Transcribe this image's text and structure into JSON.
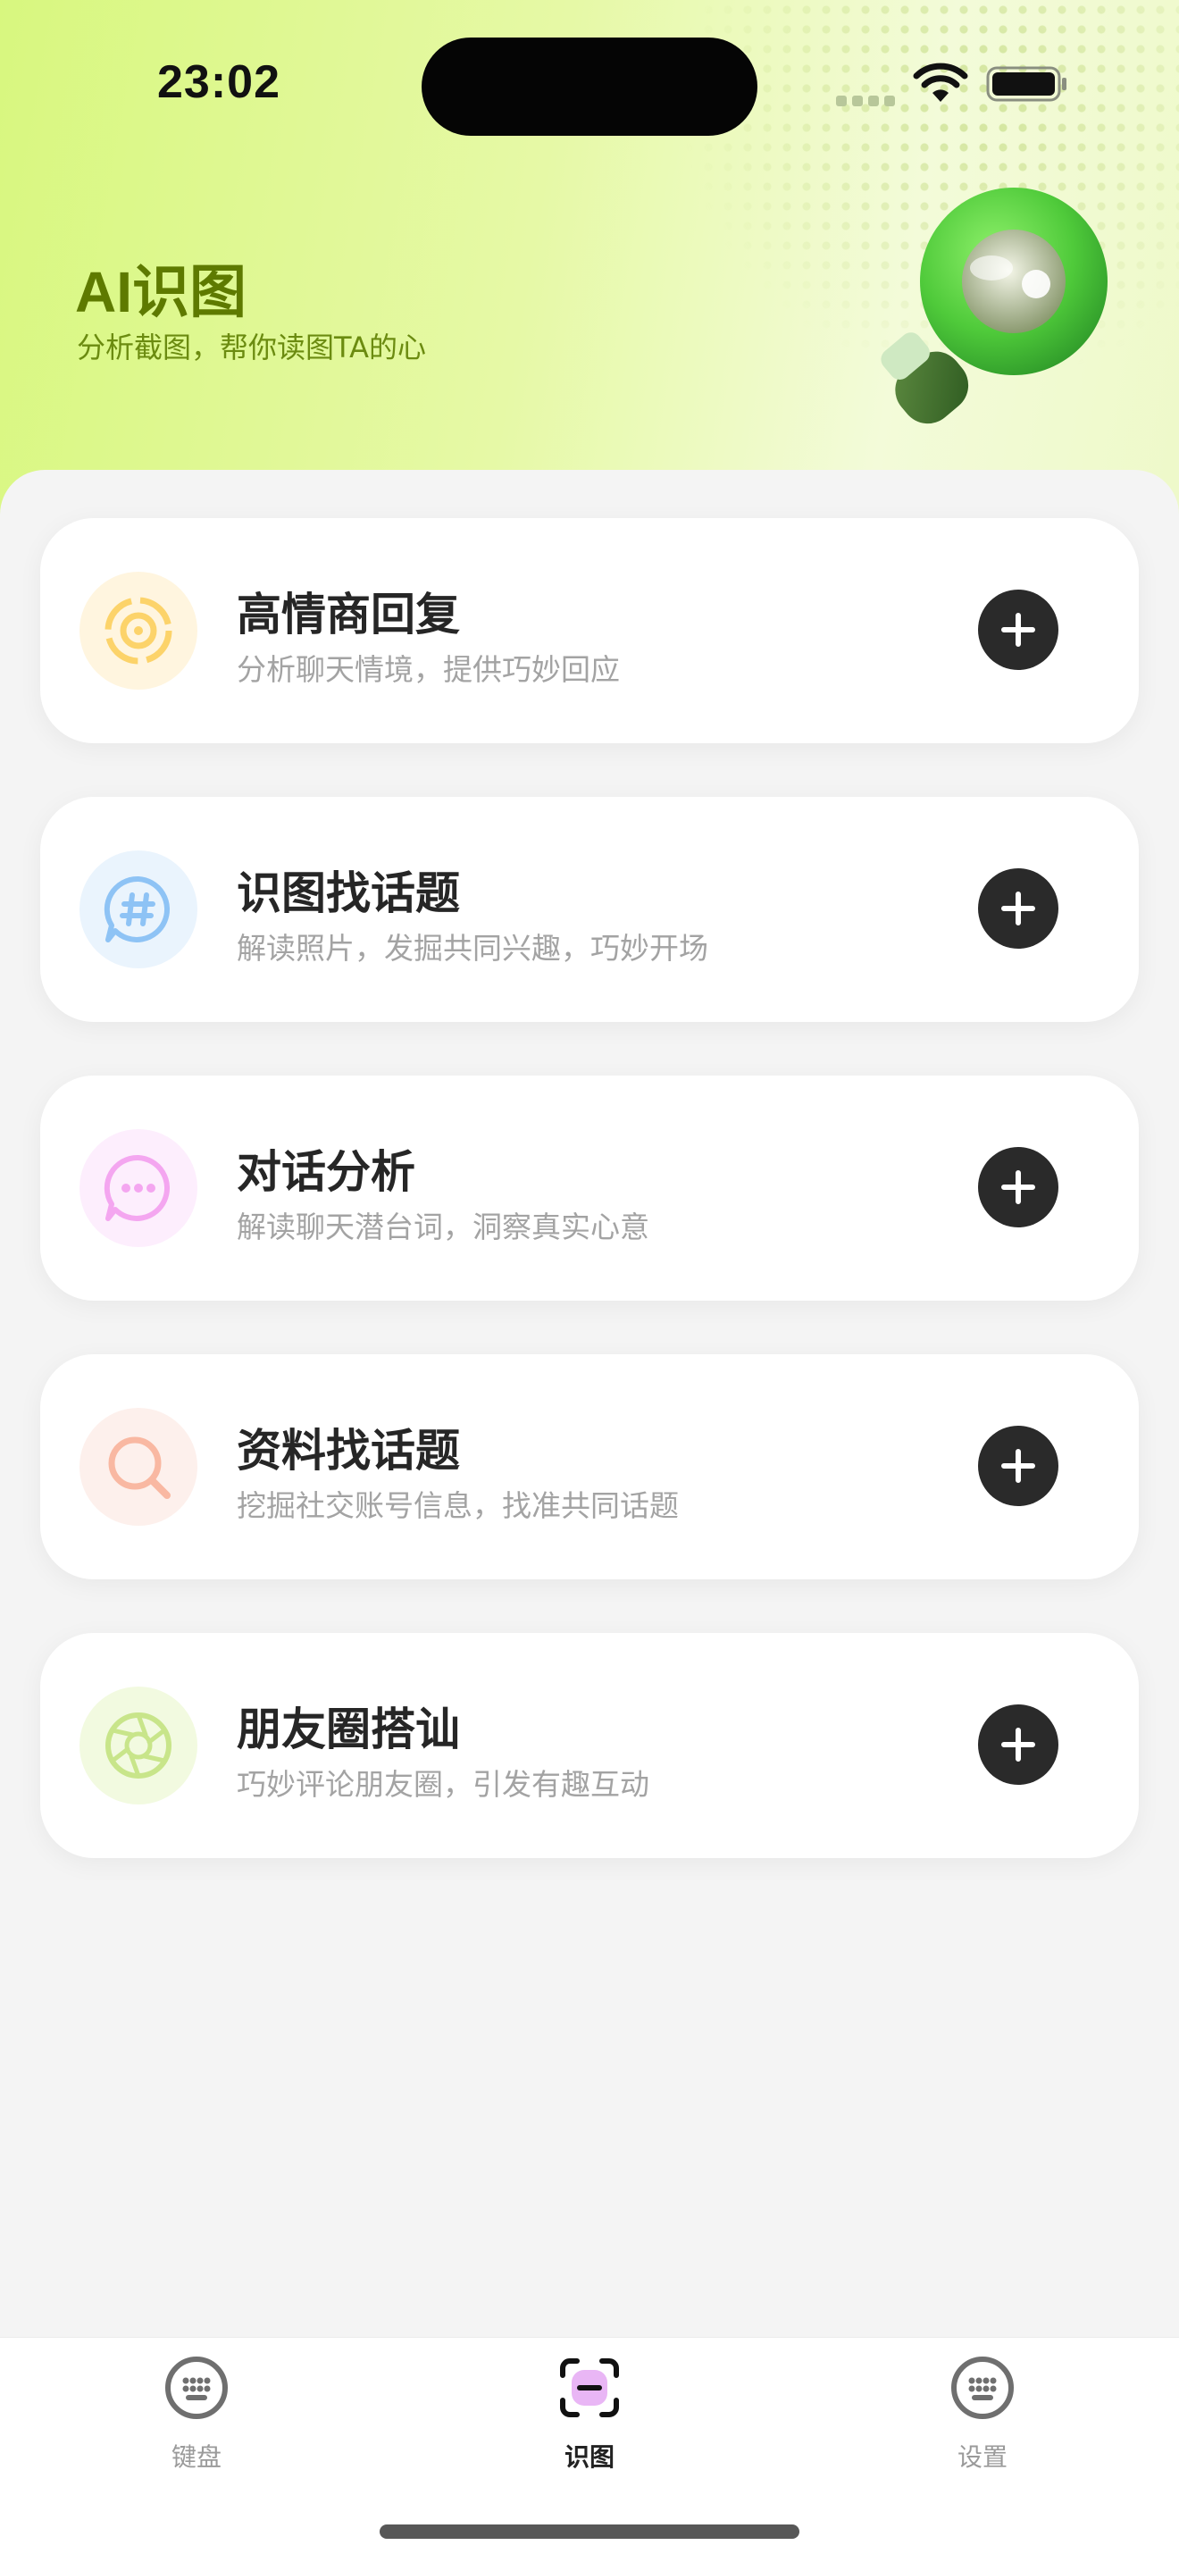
{
  "status_bar": {
    "time": "23:02"
  },
  "header": {
    "title": "AI识图",
    "subtitle": "分析截图，帮你读图TA的心",
    "illustration": "magnifier-icon",
    "accent_color": "#5e7a00"
  },
  "cards": [
    {
      "title": "高情商回复",
      "description": "分析聊天情境，提供巧妙回应",
      "icon": "target-icon",
      "icon_color": "#fcd36a",
      "icon_bg": "#fff5df"
    },
    {
      "title": "识图找话题",
      "description": "解读照片，发掘共同兴趣，巧妙开场",
      "icon": "hashtag-chat-icon",
      "icon_color": "#8ec3f5",
      "icon_bg": "#eaf4fd"
    },
    {
      "title": "对话分析",
      "description": "解读聊天潜台词，洞察真实心意",
      "icon": "chat-dots-icon",
      "icon_color": "#f4a6f0",
      "icon_bg": "#fdeefd"
    },
    {
      "title": "资料找话题",
      "description": "挖掘社交账号信息，找准共同话题",
      "icon": "search-icon",
      "icon_color": "#f9b8a2",
      "icon_bg": "#fdf0ec"
    },
    {
      "title": "朋友圈搭讪",
      "description": "巧妙评论朋友圈，引发有趣互动",
      "icon": "aperture-icon",
      "icon_color": "#c8e58a",
      "icon_bg": "#f2fae0"
    }
  ],
  "tabbar": {
    "tabs": [
      {
        "label": "键盘",
        "icon": "keyboard-icon",
        "active": false
      },
      {
        "label": "识图",
        "icon": "scan-icon",
        "active": true
      },
      {
        "label": "设置",
        "icon": "keyboard-icon",
        "active": false
      }
    ]
  }
}
